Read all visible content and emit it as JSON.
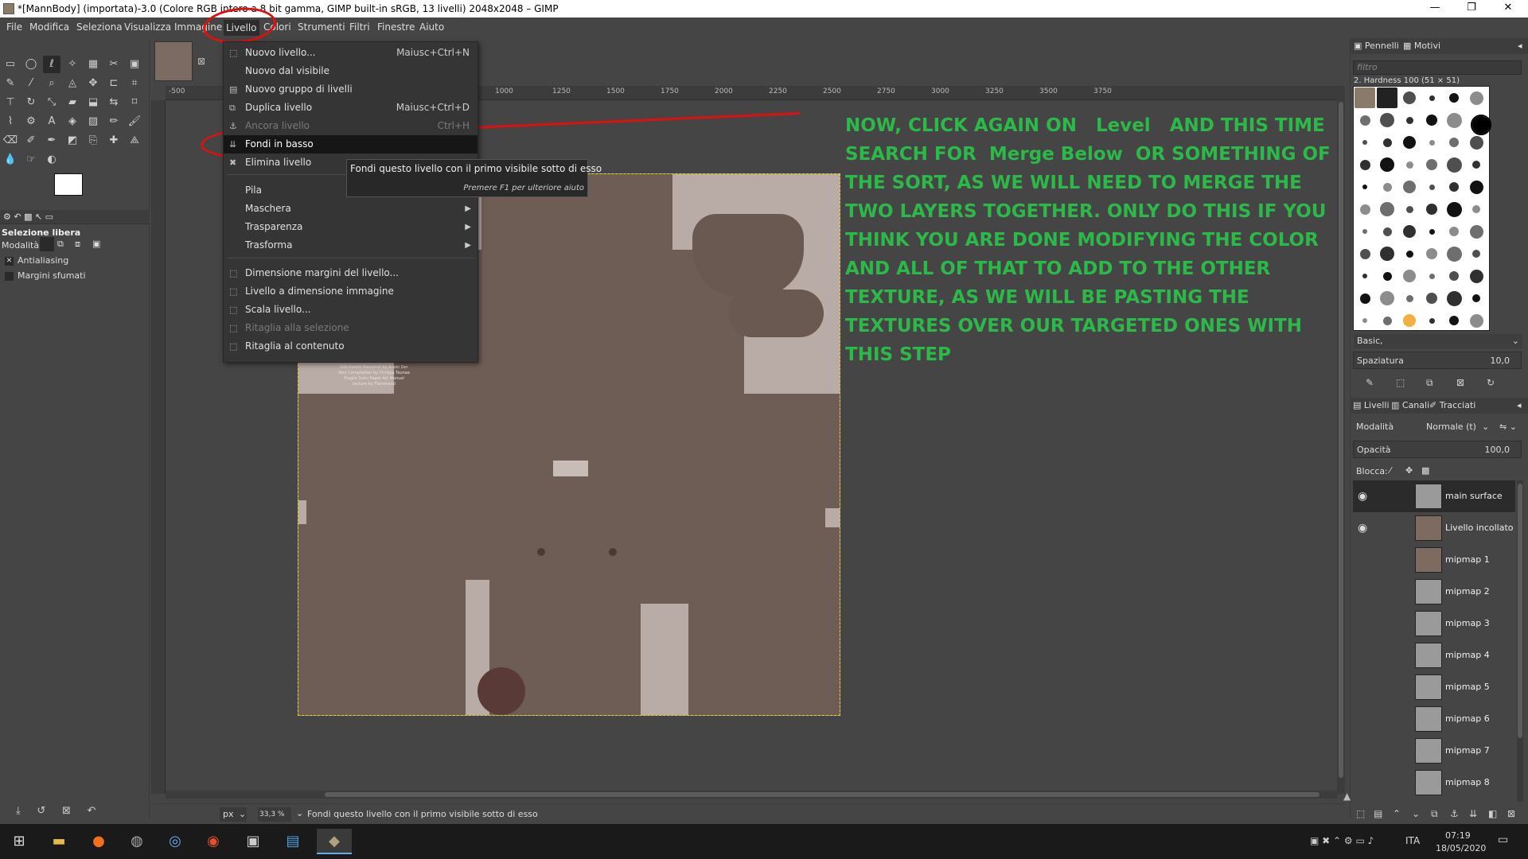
{
  "window": {
    "title": "*[MannBody] (importata)-3.0 (Colore RGB intero a 8 bit gamma, GIMP built-in sRGB, 13 livelli) 2048x2048 – GIMP",
    "minimize": "—",
    "maximize": "❐",
    "close": "✕"
  },
  "menubar": [
    "File",
    "Modifica",
    "Seleziona",
    "Visualizza",
    "Immagine",
    "Livello",
    "Colori",
    "Strumenti",
    "Filtri",
    "Finestre",
    "Aiuto"
  ],
  "layer_menu": {
    "items": [
      {
        "icon": "⬚",
        "label": "Nuovo livello...",
        "shortcut": "Maiusc+Ctrl+N"
      },
      {
        "icon": "",
        "label": "Nuovo dal visibile",
        "shortcut": ""
      },
      {
        "icon": "▤",
        "label": "Nuovo gruppo di livelli",
        "shortcut": ""
      },
      {
        "icon": "⧉",
        "label": "Duplica livello",
        "shortcut": "Maiusc+Ctrl+D"
      },
      {
        "icon": "⚓",
        "label": "Ancora livello",
        "shortcut": "Ctrl+H"
      },
      {
        "icon": "⇊",
        "label": "Fondi in basso",
        "shortcut": ""
      },
      {
        "icon": "✖",
        "label": "Elimina livello",
        "shortcut": ""
      },
      {
        "icon": "",
        "label": "Pila",
        "shortcut": ""
      },
      {
        "icon": "",
        "label": "Maschera",
        "shortcut": ""
      },
      {
        "icon": "",
        "label": "Trasparenza",
        "shortcut": ""
      },
      {
        "icon": "",
        "label": "Trasforma",
        "shortcut": ""
      },
      {
        "icon": "⬚",
        "label": "Dimensione margini del livello...",
        "shortcut": ""
      },
      {
        "icon": "⬚",
        "label": "Livello a dimensione immagine",
        "shortcut": ""
      },
      {
        "icon": "⬚",
        "label": "Scala livello...",
        "shortcut": ""
      },
      {
        "icon": "⬚",
        "label": "Ritaglia alla selezione",
        "shortcut": ""
      },
      {
        "icon": "⬚",
        "label": "Ritaglia al contenuto",
        "shortcut": ""
      }
    ],
    "submenu_arrow": "▶"
  },
  "tooltip": {
    "text": "Fondi questo livello con il primo visibile sotto di esso",
    "help": "Premere F1 per ulteriore aiuto"
  },
  "annotation": "NOW, CLICK AGAIN ON   Level   AND THIS TIME SEARCH FOR  Merge Below  OR SOMETHING OF THE SORT, AS WE WILL NEED TO MERGE THE TWO LAYERS TOGETHER. ONLY DO THIS IF YOU THINK YOU ARE DONE MODIFYING THE COLOR AND ALL OF THAT TO ADD TO THE OTHER TEXTURE, AS WE WILL BE PASTING THE TEXTURES OVER OUR TARGETED ONES WITH THIS STEP",
  "annotation_color": "#2db84a",
  "ruler_labels": [
    "-500",
    "1000",
    "1250",
    "1500",
    "1750",
    "2000",
    "2250",
    "2500",
    "2750",
    "3000",
    "3250",
    "3500",
    "3750"
  ],
  "texture_label_text": "Glitchwerk Hautshirt by Ansbi Der Skin Compilation by Chrispa Taunaa Fragile Suhu Paper Art Manual texture by Flammend",
  "tool_options": {
    "title": "Selezione libera",
    "mode_label": "Modalità:",
    "antialias": "Antialiasing",
    "feather": "Margini sfumati"
  },
  "right_dock": {
    "tabs_brushes": [
      "Pennelli",
      "Motivi"
    ],
    "filter_placeholder": "filtro",
    "brush_name": "2. Hardness 100 (51 × 51)",
    "brush_set": "Basic,",
    "spacing_label": "Spaziatura",
    "spacing_value": "10,0",
    "tabs_layers": [
      "Livelli",
      "Canali",
      "Tracciati"
    ],
    "mode_label": "Modalità",
    "mode_value": "Normale (t)",
    "opacity_label": "Opacità",
    "opacity_value": "100,0",
    "lock_label": "Blocca:",
    "layers": [
      {
        "name": "main surface",
        "visible": true,
        "thumb": "checker",
        "selected": true
      },
      {
        "name": "Livello incollato",
        "visible": true,
        "thumb": "brown",
        "selected": false
      },
      {
        "name": "mipmap 1",
        "visible": false,
        "thumb": "brown",
        "selected": false
      },
      {
        "name": "mipmap 2",
        "visible": false,
        "thumb": "checker",
        "selected": false
      },
      {
        "name": "mipmap 3",
        "visible": false,
        "thumb": "checker",
        "selected": false
      },
      {
        "name": "mipmap 4",
        "visible": false,
        "thumb": "checker",
        "selected": false
      },
      {
        "name": "mipmap 5",
        "visible": false,
        "thumb": "checker",
        "selected": false
      },
      {
        "name": "mipmap 6",
        "visible": false,
        "thumb": "checker",
        "selected": false
      },
      {
        "name": "mipmap 7",
        "visible": false,
        "thumb": "checker",
        "selected": false
      },
      {
        "name": "mipmap 8",
        "visible": false,
        "thumb": "checker",
        "selected": false
      }
    ]
  },
  "statusbar": {
    "unit": "px",
    "zoom": "33,3 %",
    "message": "Fondi questo livello con il primo visibile sotto di esso"
  },
  "taskbar": {
    "lang": "ITA",
    "time": "07:19",
    "date": "18/05/2020"
  }
}
